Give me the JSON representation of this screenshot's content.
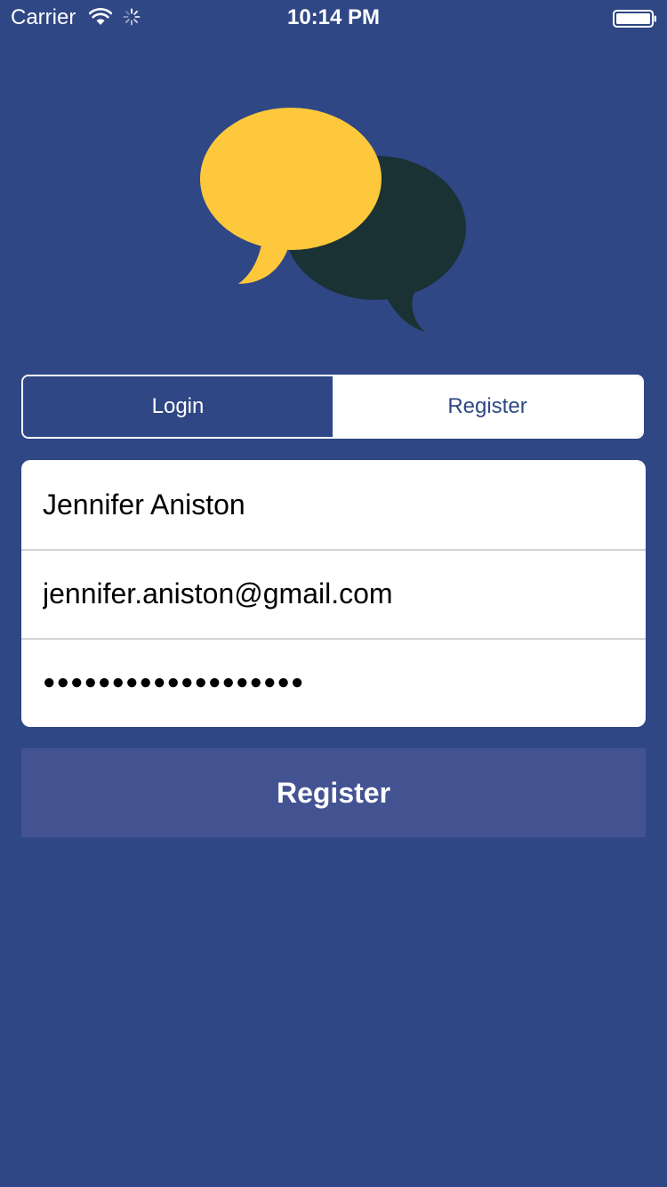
{
  "colors": {
    "background": "#2f4784",
    "logo_front_bubble": "#fdc83b",
    "logo_back_bubble": "#1a3234",
    "button_background": "#435392",
    "white": "#ffffff",
    "divider": "#d3d3d3"
  },
  "status_bar": {
    "carrier": "Carrier",
    "time": "10:14 PM",
    "icons": [
      "wifi-icon",
      "activity-spinner-icon",
      "battery-icon"
    ]
  },
  "logo": {
    "icon": "chat-bubbles-icon"
  },
  "segmented_control": {
    "selected": "Login",
    "options": [
      {
        "label": "Login"
      },
      {
        "label": "Register"
      }
    ]
  },
  "form": {
    "name_value": "Jennifer Aniston",
    "email_value": "jennifer.aniston@gmail.com",
    "password_masked": "●●●●●●●●●●●●●●●●●●●"
  },
  "submit_button": {
    "label": "Register"
  }
}
